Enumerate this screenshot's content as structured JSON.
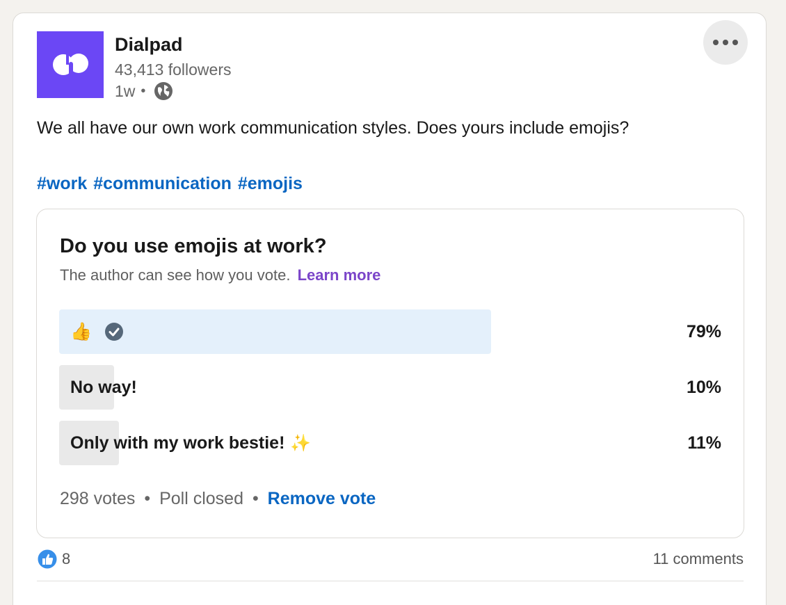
{
  "post": {
    "author": "Dialpad",
    "followers": "43,413 followers",
    "age": "1w",
    "meta_separator": "•",
    "text": "We all have our own work communication styles. Does yours include emojis?",
    "hashtags": [
      "#work",
      "#communication",
      "#emojis"
    ]
  },
  "poll": {
    "question": "Do you use emojis at work?",
    "note": "The author can see how you vote.",
    "learn_more": "Learn more",
    "options": [
      {
        "label": "👍",
        "percent_text": "79%",
        "percent": 79,
        "selected": true
      },
      {
        "label": "No way!",
        "percent_text": "10%",
        "percent": 10,
        "selected": false
      },
      {
        "label": "Only with my work bestie!",
        "percent_text": "11%",
        "percent": 11,
        "selected": false,
        "suffix": "✨"
      }
    ],
    "votes": "298 votes",
    "status": "Poll closed",
    "remove_vote": "Remove vote",
    "separator": "•"
  },
  "social": {
    "reactions": "8",
    "comments": "11 comments"
  },
  "colors": {
    "brand": "#6b47f5",
    "link": "#0a66c2",
    "learn_more": "#7b45c9",
    "selected_fill": "#e4f0fb",
    "unselected_fill": "#e9e9e9"
  },
  "icons": {
    "more": "ellipsis-icon",
    "visibility": "globe-icon",
    "vote_check": "check-circle-icon",
    "reaction": "like-reaction-icon"
  }
}
